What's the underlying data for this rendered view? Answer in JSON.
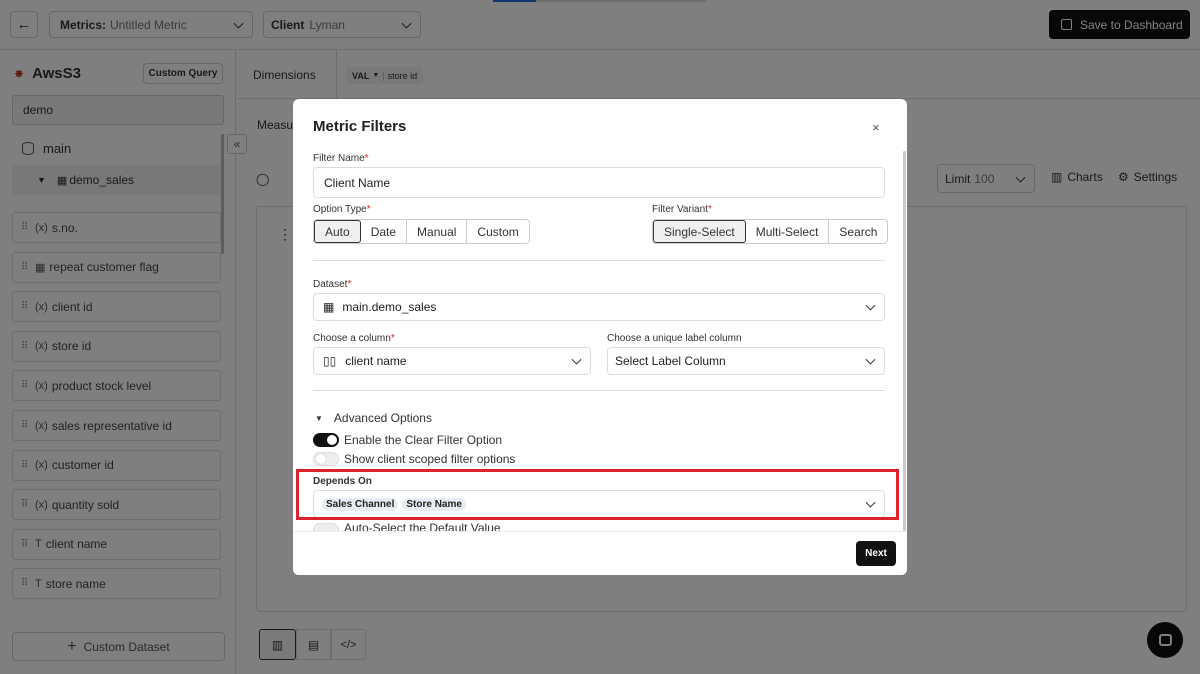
{
  "topbar": {
    "metrics_label": "Metrics:",
    "metrics_value": "Untitled Metric",
    "client_label": "Client",
    "client_value": "Lyman",
    "save_button": "Save to Dashboard",
    "progress_fraction": 0.2
  },
  "sidebar": {
    "source_name": "AwsS3",
    "custom_query_button": "Custom Query",
    "search_value": "demo",
    "schema": "main",
    "table": "demo_sales",
    "fields": [
      {
        "icon": "(x)",
        "label": "s.no."
      },
      {
        "icon": "▦",
        "label": "repeat customer flag"
      },
      {
        "icon": "(x)",
        "label": "client id"
      },
      {
        "icon": "(x)",
        "label": "store id"
      },
      {
        "icon": "(x)",
        "label": "product stock level"
      },
      {
        "icon": "(x)",
        "label": "sales representative id"
      },
      {
        "icon": "(x)",
        "label": "customer id"
      },
      {
        "icon": "(x)",
        "label": "quantity sold"
      },
      {
        "icon": "T",
        "label": "client name"
      },
      {
        "icon": "T",
        "label": "store name"
      }
    ],
    "custom_dataset_button": "Custom Dataset"
  },
  "main": {
    "dimensions_label": "Dimensions",
    "dimension_chip_prefix": "VAL",
    "dimension_chip_value": "store id",
    "measures_label": "Measu",
    "limit_label": "Limit",
    "limit_value": "100",
    "charts_label": "Charts",
    "settings_label": "Settings"
  },
  "modal": {
    "title": "Metric Filters",
    "close": "×",
    "filter_name_label": "Filter Name",
    "filter_name_value": "Client Name",
    "option_type_label": "Option Type",
    "option_types": [
      "Auto",
      "Date",
      "Manual",
      "Custom"
    ],
    "option_type_selected": "Auto",
    "filter_variant_label": "Filter Variant",
    "filter_variants": [
      "Single-Select",
      "Multi-Select",
      "Search"
    ],
    "filter_variant_selected": "Single-Select",
    "dataset_label": "Dataset",
    "dataset_value": "main.demo_sales",
    "column_label": "Choose a column",
    "column_value": "client name",
    "unique_label_label": "Choose a unique label column",
    "unique_label_value": "Select Label Column",
    "advanced_options": "Advanced Options",
    "enable_clear_filter": "Enable the Clear Filter Option",
    "enable_clear_filter_on": true,
    "show_client_scoped": "Show client scoped filter options",
    "show_client_scoped_on": false,
    "depends_on_label": "Depends On",
    "depends_on_values": [
      "Sales Channel",
      "Store Name"
    ],
    "auto_select_default": "Auto-Select the Default Value",
    "next_button": "Next"
  },
  "colors": {
    "accent_dark": "#111111",
    "highlight_red": "#d8242a",
    "progress_blue": "#1e6fd9",
    "source_icon_red": "#c0392b"
  }
}
